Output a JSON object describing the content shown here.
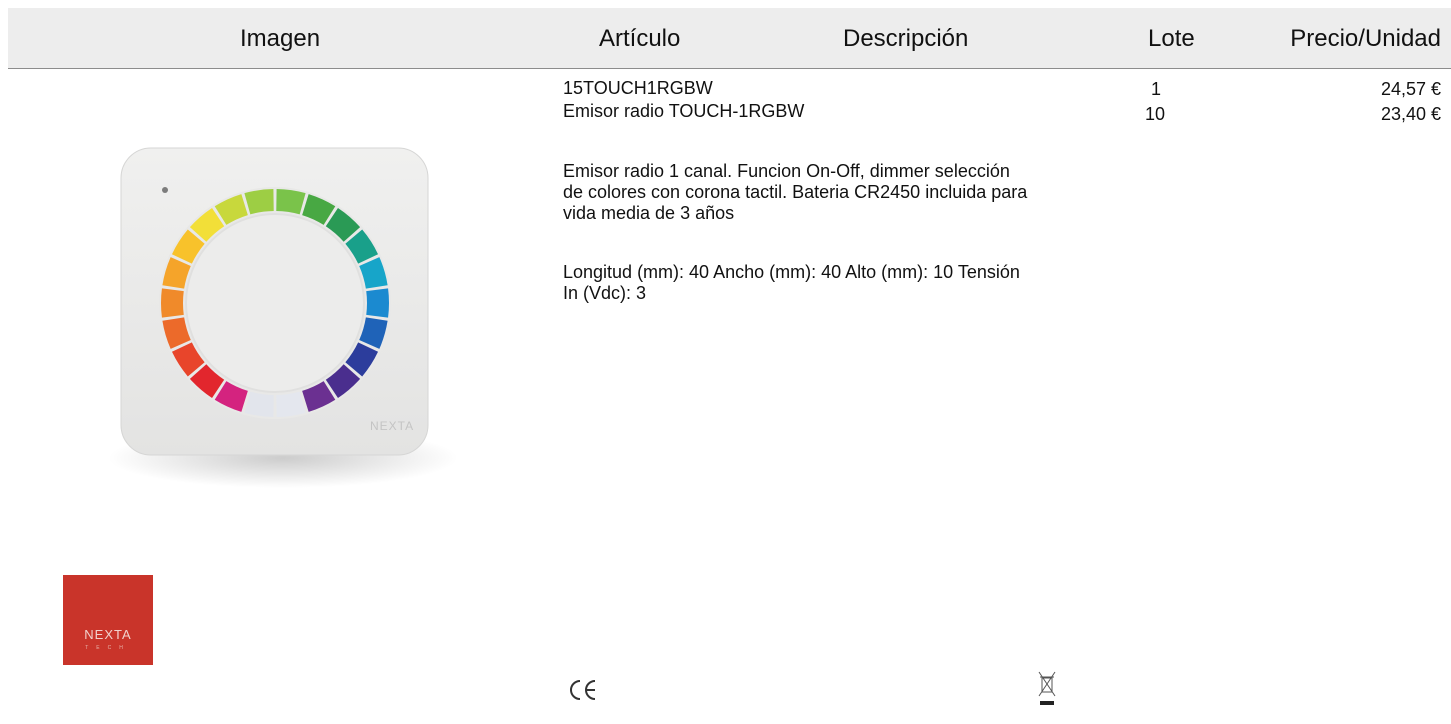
{
  "header": {
    "image": "Imagen",
    "article": "Artículo",
    "description": "Descripción",
    "lot": "Lote",
    "price_unit": "Precio/Unidad"
  },
  "product": {
    "code": "15TOUCH1RGBW",
    "name": "Emisor radio TOUCH-1RGBW",
    "description": "Emisor radio 1 canal. Funcion On-Off, dimmer selección de colores con corona tactil. Bateria CR2450 incluida para vida media de 3 años",
    "dimensions": "Longitud (mm): 40 Ancho (mm): 40 Alto (mm): 10 Tensión In (Vdc): 3",
    "device_brand": "NEXTA"
  },
  "pricing": [
    {
      "lot": "1",
      "price": "24,57 €"
    },
    {
      "lot": "10",
      "price": "23,40 €"
    }
  ],
  "brand_logo": {
    "word": "NEXTA",
    "sub": "TECH",
    "color": "#c9342a"
  },
  "ring_colors": [
    "#7ac34a",
    "#48a843",
    "#2a9a55",
    "#19a08a",
    "#17a5c9",
    "#1b8ad0",
    "#1f63b8",
    "#2c3d9c",
    "#4a2e8e",
    "#6b3091",
    "#e4e7ee",
    "#e2e5ec",
    "#d4237f",
    "#e2262d",
    "#e8452b",
    "#ec6a2a",
    "#f08a2a",
    "#f5a42a",
    "#f8c22b",
    "#f2df38",
    "#c8d83c",
    "#9dce44"
  ],
  "icons": [
    "ce-mark-icon",
    "weee-bin-icon"
  ]
}
